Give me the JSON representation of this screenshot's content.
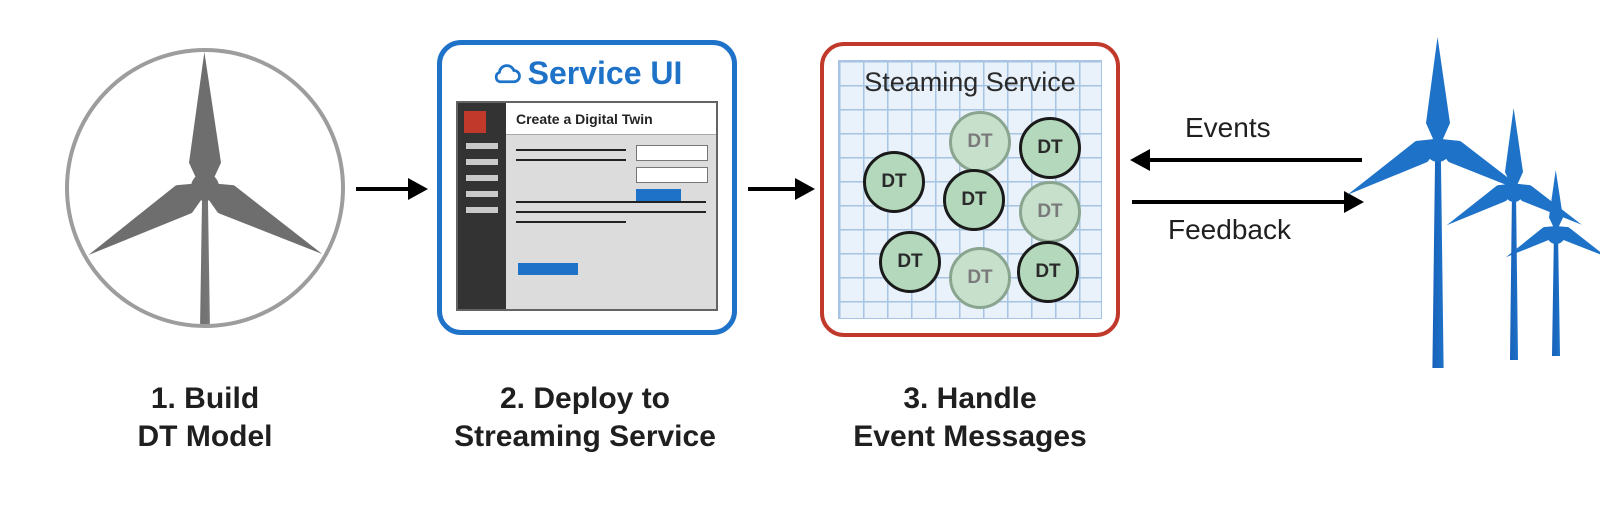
{
  "steps": {
    "one": {
      "caption_l1": "1. Build",
      "caption_l2": "DT Model"
    },
    "two": {
      "caption_l1": "2. Deploy to",
      "caption_l2": "Streaming Service",
      "panel_title": "Service UI",
      "form_title": "Create a Digital Twin"
    },
    "three": {
      "caption_l1": "3. Handle",
      "caption_l2": "Event Messages",
      "panel_title": "Steaming Service",
      "node_label": "DT"
    }
  },
  "exchange": {
    "events": "Events",
    "feedback": "Feedback"
  },
  "colors": {
    "accent_blue": "#1e73c9",
    "accent_red": "#c0392b",
    "grey": "#6e6e6e"
  }
}
